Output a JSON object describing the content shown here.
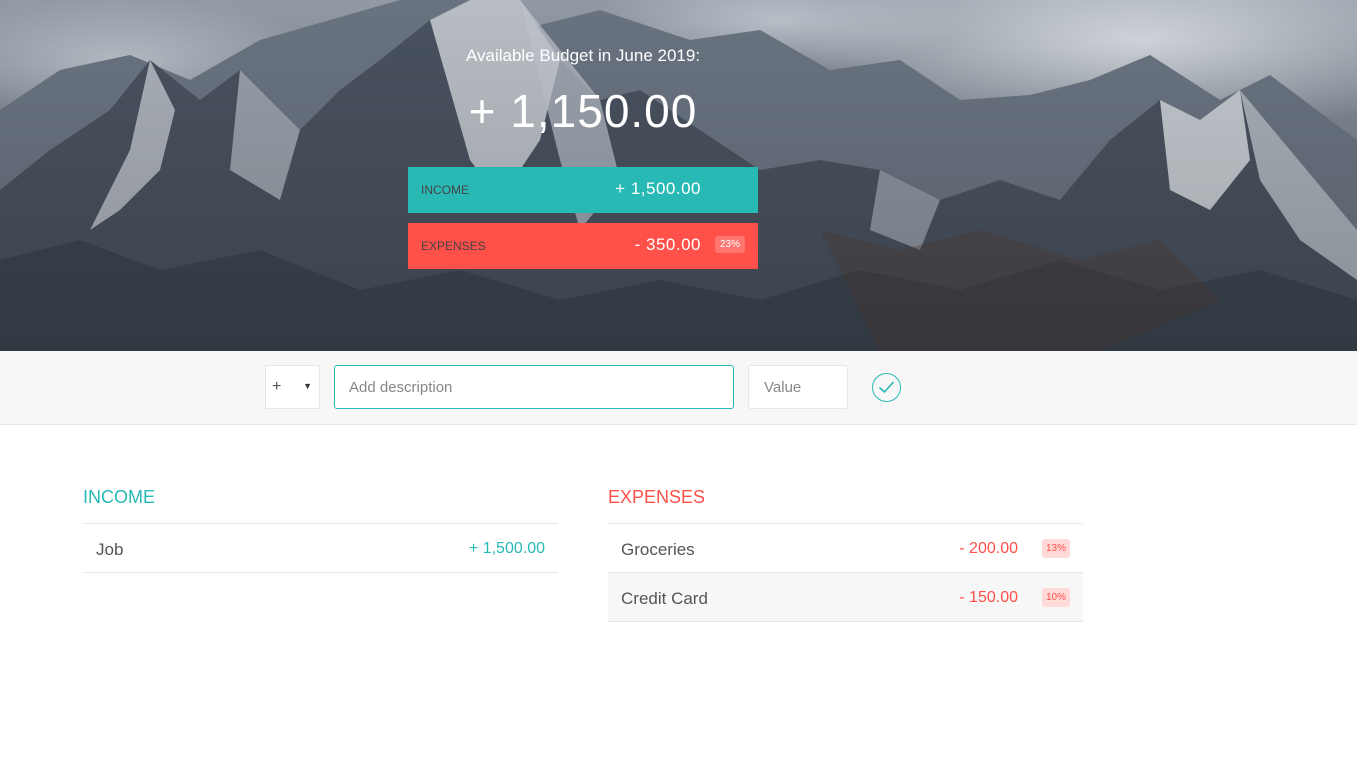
{
  "colors": {
    "income": "#28b9b5",
    "expenses": "#ff5049",
    "bar_background": "#f7f7f7"
  },
  "header": {
    "title": "Available Budget in June 2019:",
    "budget_value": "+ 1,150.00",
    "income_label": "Income",
    "income_value": "+ 1,500.00",
    "expenses_label": "Expenses",
    "expenses_value": "- 350.00",
    "expenses_percentage": "23%"
  },
  "add_bar": {
    "type_value": "+",
    "description_placeholder": "Add description",
    "value_placeholder": "Value",
    "submit_icon": "checkmark-circle-icon"
  },
  "income_list": {
    "title": "Income",
    "items": [
      {
        "description": "Job",
        "value": "+ 1,500.00"
      }
    ]
  },
  "expenses_list": {
    "title": "Expenses",
    "items": [
      {
        "description": "Groceries",
        "value": "- 200.00",
        "percentage": "13%"
      },
      {
        "description": "Credit Card",
        "value": "- 150.00",
        "percentage": "10%"
      }
    ]
  }
}
